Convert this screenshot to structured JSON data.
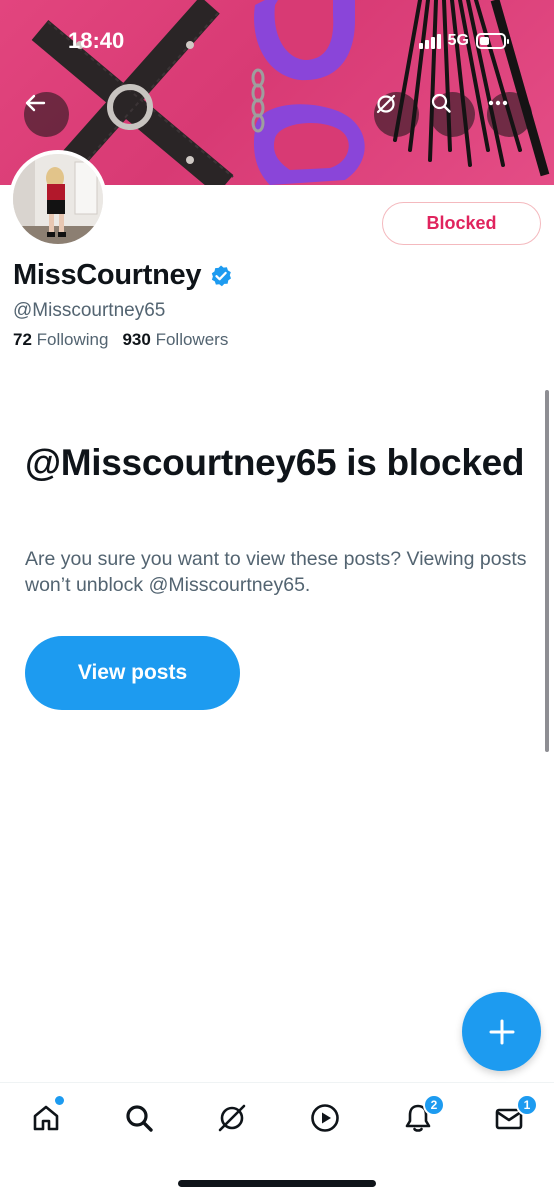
{
  "status_bar": {
    "time": "18:40",
    "network": "5G"
  },
  "profile": {
    "name": "MissCourtney",
    "handle": "@Misscourtney65",
    "following_count": "72",
    "following_label": "Following",
    "followers_count": "930",
    "followers_label": "Followers",
    "blocked_button_label": "Blocked"
  },
  "blocked_notice": {
    "title": "@Misscourtney65 is blocked",
    "description": "Are you sure you want to view these posts? Viewing posts won’t unblock @Misscourtney65.",
    "view_button_label": "View posts"
  },
  "nav": {
    "items": [
      "home-icon",
      "search-icon",
      "grok-icon",
      "video-icon",
      "notifications-icon",
      "messages-icon"
    ],
    "notifications_badge": "2",
    "messages_badge": "1"
  },
  "colors": {
    "accent": "#1d9bf0",
    "blocked_red": "#e0245e",
    "banner_pink": "#e2457e",
    "text_primary": "#0f1419",
    "text_secondary": "#536471"
  }
}
